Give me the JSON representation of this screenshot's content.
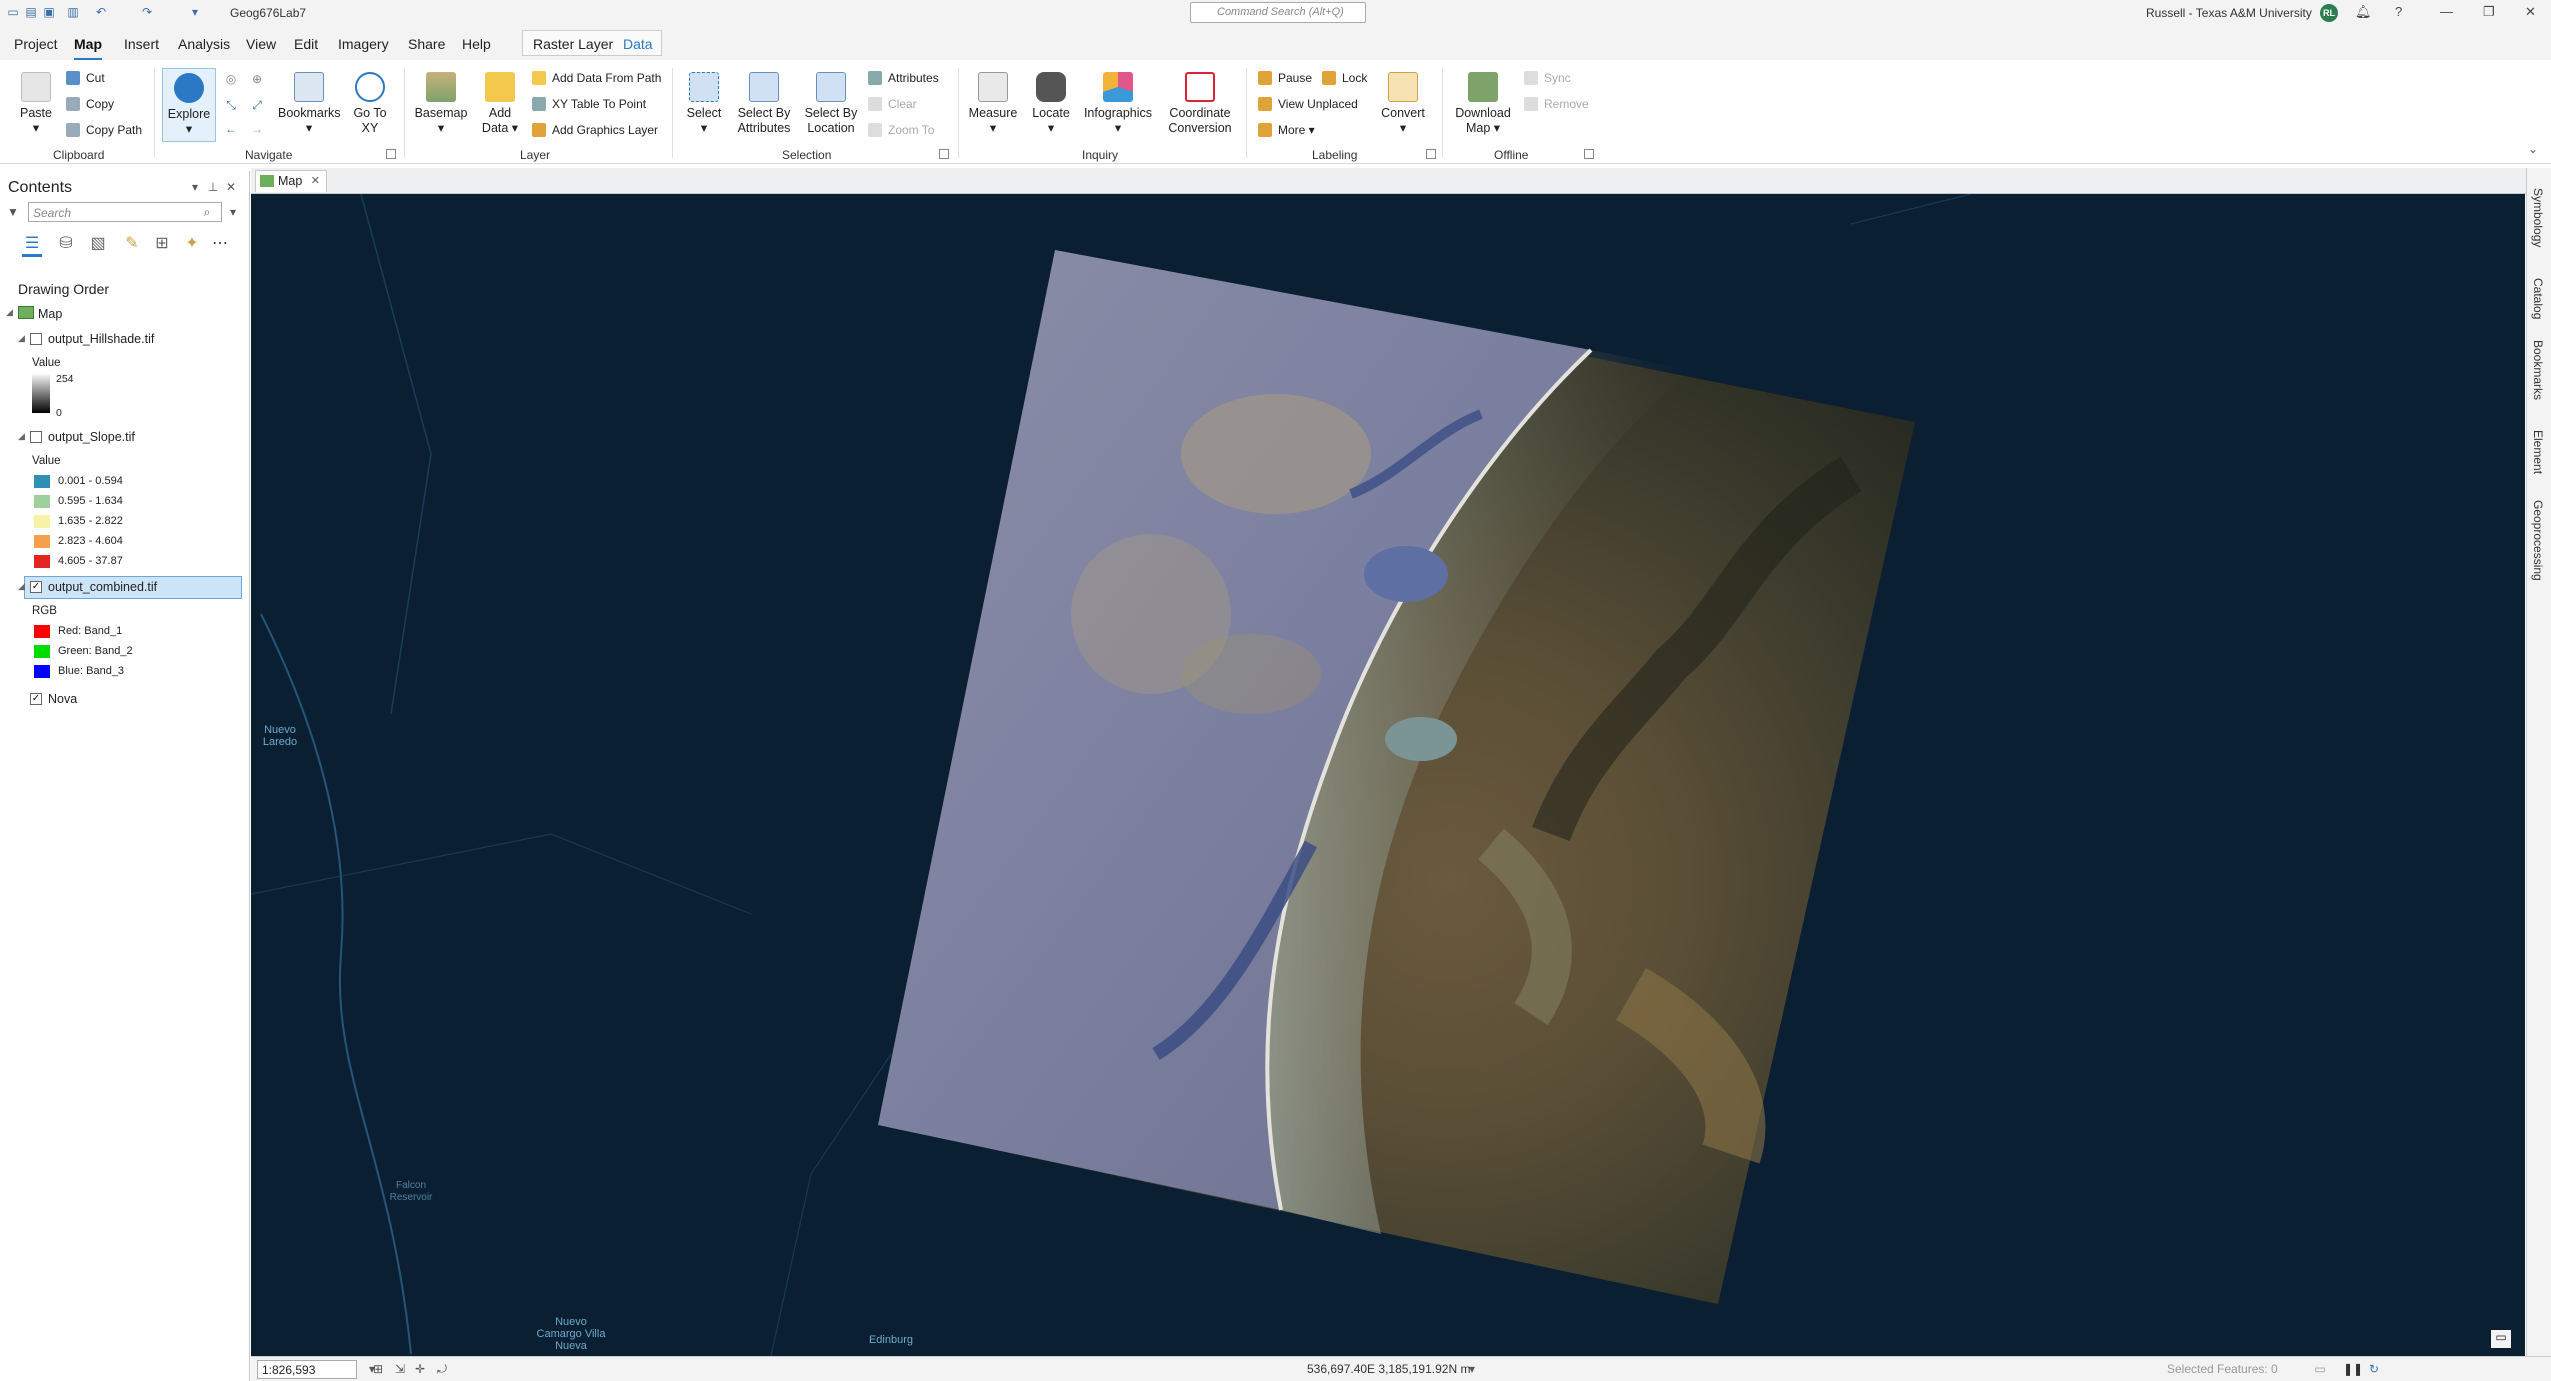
{
  "titlebar": {
    "project": "Geog676Lab7",
    "command_search": "Command Search (Alt+Q)",
    "user": "Russell - Texas A&M University",
    "avatar": "RL"
  },
  "menu": {
    "tabs": [
      "Project",
      "Map",
      "Insert",
      "Analysis",
      "View",
      "Edit",
      "Imagery",
      "Share",
      "Help"
    ],
    "context_tabs": [
      "Raster Layer",
      "Data"
    ]
  },
  "ribbon": {
    "clipboard": {
      "paste": "Paste",
      "cut": "Cut",
      "copy": "Copy",
      "copy_path": "Copy Path",
      "group": "Clipboard"
    },
    "navigate": {
      "explore": "Explore",
      "bookmarks": "Bookmarks",
      "go_to": "Go To XY",
      "group": "Navigate"
    },
    "layer": {
      "basemap": "Basemap",
      "add_data": "Add Data",
      "add_from_path": "Add Data From Path",
      "xy_table": "XY Table To Point",
      "graphics": "Add Graphics Layer",
      "group": "Layer"
    },
    "selection": {
      "select": "Select",
      "by_attributes": "Select By Attributes",
      "by_location": "Select By Location",
      "attributes": "Attributes",
      "clear": "Clear",
      "zoom_to": "Zoom To",
      "group": "Selection"
    },
    "inquiry": {
      "measure": "Measure",
      "locate": "Locate",
      "infographics": "Infographics",
      "coord": "Coordinate Conversion",
      "group": "Inquiry"
    },
    "labeling": {
      "pause": "Pause",
      "lock": "Lock",
      "view_unplaced": "View Unplaced",
      "more": "More",
      "convert": "Convert",
      "group": "Labeling"
    },
    "offline": {
      "download": "Download Map",
      "sync": "Sync",
      "remove": "Remove",
      "group": "Offline"
    }
  },
  "contents": {
    "title": "Contents",
    "search_placeholder": "Search",
    "drawing_order": "Drawing Order",
    "map": "Map",
    "layers": [
      {
        "name": "output_Hillshade.tif",
        "value_label": "Value",
        "high": "254",
        "low": "0"
      },
      {
        "name": "output_Slope.tif",
        "value_label": "Value",
        "classes": [
          {
            "label": "0.001 - 0.594",
            "color": "#2f8fb5"
          },
          {
            "label": "0.595 - 1.634",
            "color": "#9fcf9c"
          },
          {
            "label": "1.635 - 2.822",
            "color": "#f6f3a6"
          },
          {
            "label": "2.823 - 4.604",
            "color": "#f6a04d"
          },
          {
            "label": "4.605 - 37.87",
            "color": "#e2261f"
          }
        ]
      },
      {
        "name": "output_combined.tif",
        "rgb_label": "RGB",
        "bands": [
          {
            "label": "Red:  Band_1",
            "color": "#ff0000"
          },
          {
            "label": "Green: Band_2",
            "color": "#00dd00"
          },
          {
            "label": "Blue:  Band_3",
            "color": "#0000ff"
          }
        ]
      },
      {
        "name": "Nova"
      }
    ]
  },
  "map_tab": "Map",
  "map_labels": {
    "nuevo_laredo": "Nuevo Laredo",
    "falcon": "Falcon Reservoir",
    "camargo": "Nuevo Camargo Villa Nueva",
    "edinburg": "Edinburg"
  },
  "right_panes": [
    "Symbology",
    "Catalog",
    "Bookmarks",
    "Element",
    "Geoprocessing"
  ],
  "status": {
    "scale": "1:826,593",
    "coords": "536,697.40E 3,185,191.92N m",
    "selected": "Selected Features: 0"
  }
}
